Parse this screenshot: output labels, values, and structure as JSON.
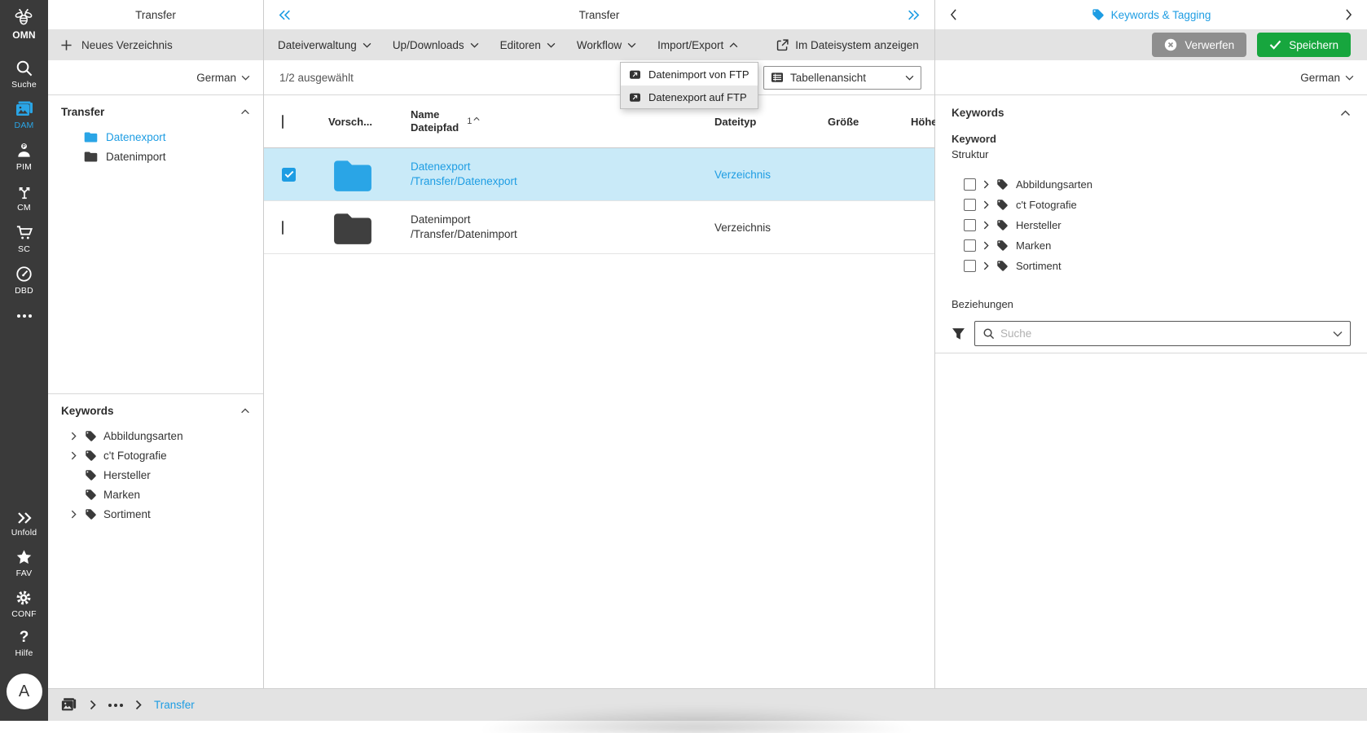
{
  "colors": {
    "accent": "#1e9de3",
    "save_green": "#17a63e",
    "discard_gray": "#8e8e8e",
    "selected_row": "#c9eaf8",
    "sidebar_bg": "#3a3a3a"
  },
  "sidebar": {
    "logo": {
      "label": "OMN",
      "icon": "bee-logo-icon"
    },
    "items": [
      {
        "label": "Suche",
        "icon": "search-icon"
      },
      {
        "label": "DAM",
        "icon": "dam-images-icon",
        "active": true
      },
      {
        "label": "PIM",
        "icon": "pim-person-icon"
      },
      {
        "label": "CM",
        "icon": "cm-branch-icon"
      },
      {
        "label": "SC",
        "icon": "cart-icon"
      },
      {
        "label": "DBD",
        "icon": "dashboard-gauge-icon"
      }
    ],
    "more_icon": "ellipsis-icon",
    "bottom_items": [
      {
        "label": "Unfold",
        "icon": "unfold-double-chevron-icon"
      },
      {
        "label": "FAV",
        "icon": "star-icon"
      },
      {
        "label": "CONF",
        "icon": "gear-icon"
      },
      {
        "label": "Hilfe",
        "icon": "question-icon",
        "glyph": "?"
      }
    ],
    "avatar": {
      "initial": "A"
    }
  },
  "left_panel": {
    "title": "Transfer",
    "new_directory_label": "Neues Verzeichnis",
    "language": "German",
    "transfer_section": {
      "title": "Transfer",
      "items": [
        {
          "label": "Datenexport",
          "selected": true
        },
        {
          "label": "Datenimport",
          "selected": false
        }
      ]
    },
    "keywords_section": {
      "title": "Keywords",
      "items": [
        {
          "label": "Abbildungsarten",
          "expandable": true
        },
        {
          "label": "c't Fotografie",
          "expandable": true
        },
        {
          "label": "Hersteller",
          "expandable": false
        },
        {
          "label": "Marken",
          "expandable": false
        },
        {
          "label": "Sortiment",
          "expandable": true
        }
      ]
    }
  },
  "center_panel": {
    "title": "Transfer",
    "menus": [
      {
        "label": "Dateiverwaltung"
      },
      {
        "label": "Up/Downloads"
      },
      {
        "label": "Editoren"
      },
      {
        "label": "Workflow"
      },
      {
        "label": "Import/Export",
        "open": true
      }
    ],
    "filesystem_action": "Im Dateisystem anzeigen",
    "selection_status": "1/2 ausgewählt",
    "view_mode": "Tabellenansicht",
    "open_menu": {
      "items": [
        {
          "label": "Datenimport von FTP",
          "icon": "ftp-transfer-icon"
        },
        {
          "label": "Datenexport auf FTP",
          "icon": "ftp-transfer-icon"
        }
      ]
    },
    "table": {
      "columns": {
        "vorschau": "Vorsch...",
        "name_line1": "Name",
        "name_line2": "Dateipfad",
        "sort_badge": "1",
        "dateityp": "Dateityp",
        "groesse": "Größe",
        "hoehe": "Höhe"
      },
      "rows": [
        {
          "name": "Datenexport",
          "path": "/Transfer/Datenexport",
          "type": "Verzeichnis",
          "selected": true
        },
        {
          "name": "Datenimport",
          "path": "/Transfer/Datenimport",
          "type": "Verzeichnis",
          "selected": false
        }
      ]
    }
  },
  "right_panel": {
    "title": "Keywords & Tagging",
    "discard_label": "Verwerfen",
    "save_label": "Speichern",
    "language": "German",
    "section_title": "Keywords",
    "field_label": "Keyword",
    "field_sublabel": "Struktur",
    "tree": [
      {
        "label": "Abbildungsarten"
      },
      {
        "label": "c't Fotografie"
      },
      {
        "label": "Hersteller"
      },
      {
        "label": "Marken"
      },
      {
        "label": "Sortiment"
      }
    ],
    "relations_label": "Beziehungen",
    "search_placeholder": "Suche"
  },
  "bottom_bar": {
    "breadcrumb_current": "Transfer"
  }
}
